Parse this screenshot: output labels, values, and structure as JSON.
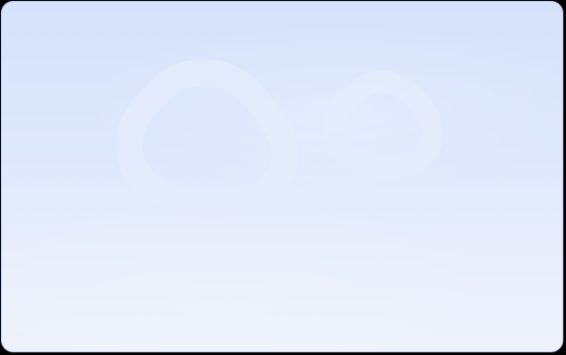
{
  "screen": {
    "title": "",
    "decor": {
      "icons": [
        "rounded-square-outline-icon",
        "rounded-square-outline-icon"
      ]
    },
    "colors": {
      "page_background": "#000000",
      "panel_top": "#d6e2fb",
      "panel_bottom": "#eef2fc",
      "panel_border": "#b7c9f3",
      "shape_stroke": "#e4ebfb"
    }
  }
}
